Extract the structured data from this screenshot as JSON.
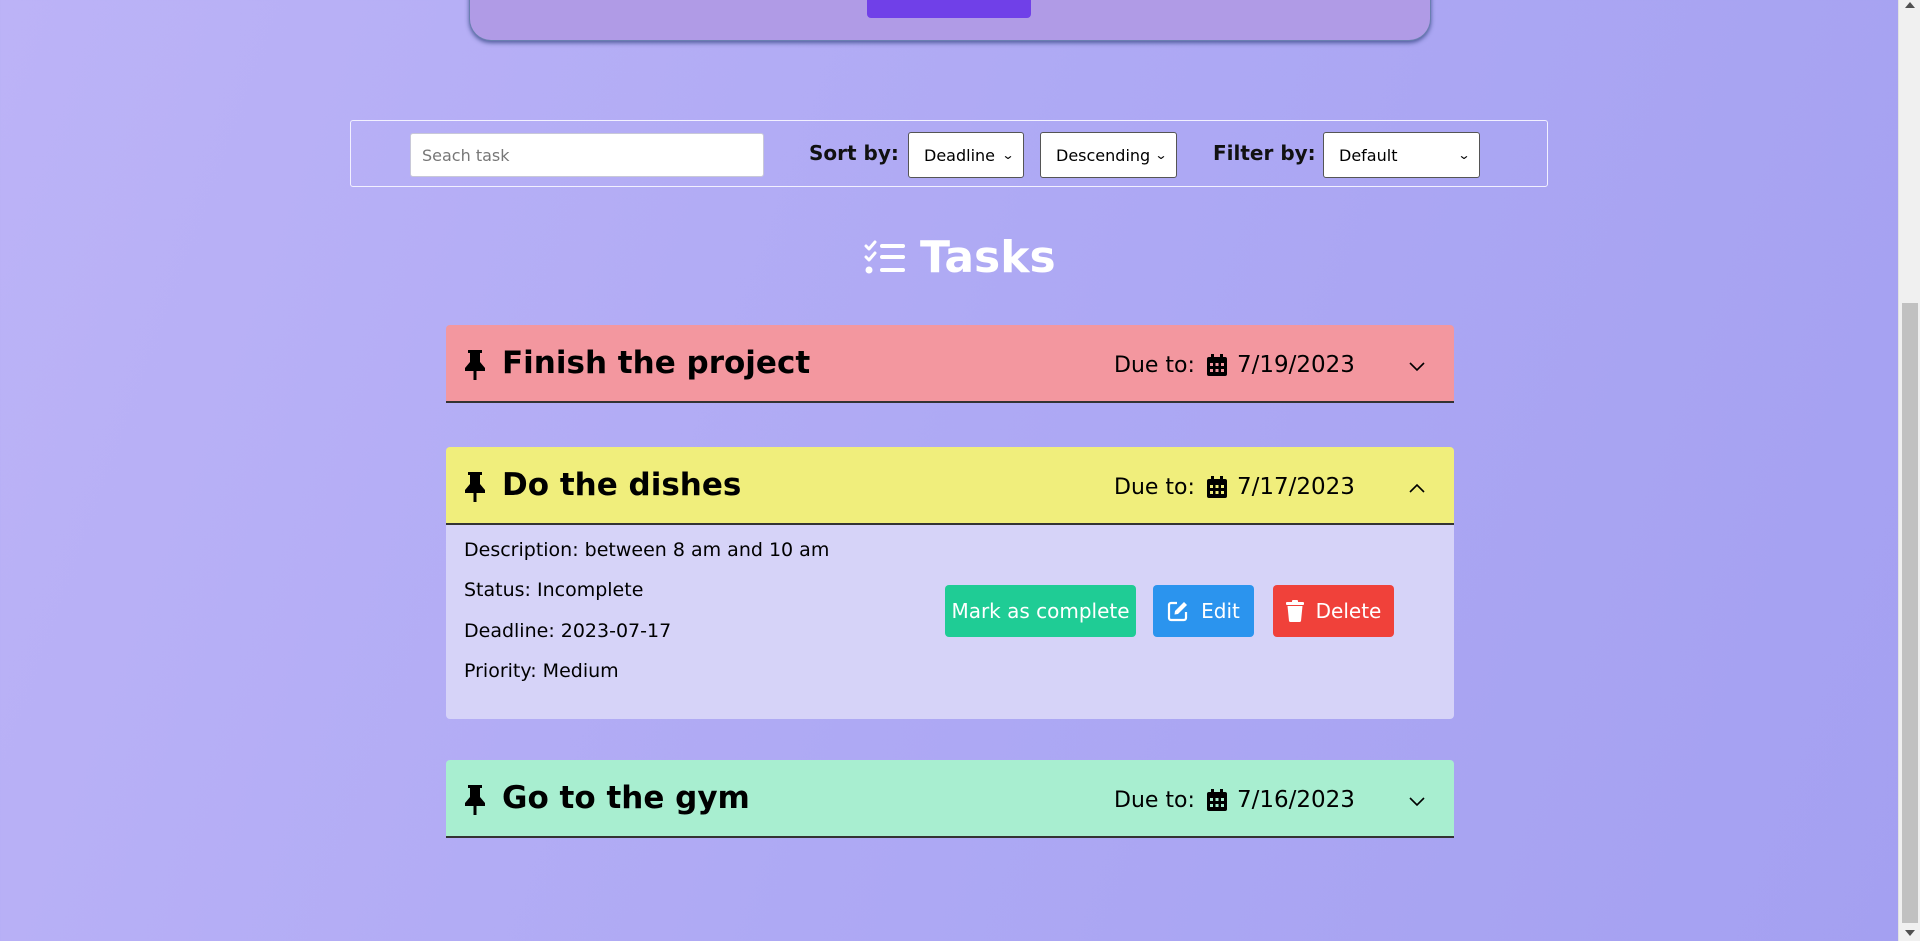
{
  "toolbar": {
    "search_placeholder": "Seach task",
    "sort_label": "Sort by:",
    "sort_field": "Deadline",
    "sort_order": "Descending",
    "filter_label": "Filter by:",
    "filter_value": "Default"
  },
  "header": {
    "title": "Tasks",
    "icon": "list-check-icon"
  },
  "tasks": [
    {
      "title": "Finish the project",
      "due_label": "Due to:",
      "due_date": "7/19/2023",
      "color": "#f3979f",
      "expanded": false
    },
    {
      "title": "Do the dishes",
      "due_label": "Due to:",
      "due_date": "7/17/2023",
      "color": "#f0ee7c",
      "expanded": true,
      "details": {
        "description": "Description: between 8 am and 10 am",
        "status": "Status: Incomplete",
        "deadline": "Deadline: 2023-07-17",
        "priority": "Priority: Medium"
      },
      "actions": {
        "complete_label": "Mark as complete",
        "edit_label": "Edit",
        "delete_label": "Delete",
        "complete_color": "#1fcc95",
        "edit_color": "#2b94ee",
        "delete_color": "#f0413a"
      }
    },
    {
      "title": "Go to the gym",
      "due_label": "Due to:",
      "due_date": "7/16/2023",
      "color": "#a8eed0",
      "expanded": false
    }
  ]
}
